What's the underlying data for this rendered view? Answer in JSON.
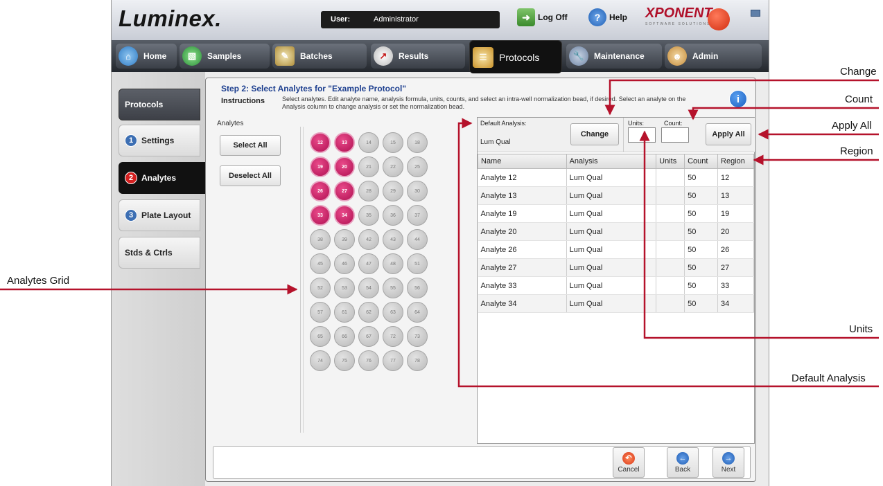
{
  "header": {
    "logo": "Luminex.",
    "user_label": "User:",
    "user_value": "Administrator",
    "logoff_label": "Log Off",
    "help_label": "Help",
    "brand": "XPONENT.",
    "brand_sub": "SOFTWARE SOLUTIONS"
  },
  "nav": {
    "tabs": [
      {
        "label": "Home",
        "icon": "home-icon"
      },
      {
        "label": "Samples",
        "icon": "samples-icon"
      },
      {
        "label": "Batches",
        "icon": "batches-icon"
      },
      {
        "label": "Results",
        "icon": "results-icon"
      },
      {
        "label": "Protocols",
        "icon": "protocols-icon",
        "active": true
      },
      {
        "label": "Maintenance",
        "icon": "maintenance-icon"
      },
      {
        "label": "Admin",
        "icon": "admin-icon"
      }
    ]
  },
  "sidebar": {
    "items": [
      {
        "label": "Protocols"
      },
      {
        "label": "Settings",
        "step": "1"
      },
      {
        "label": "Analytes",
        "step": "2"
      },
      {
        "label": "Plate Layout",
        "step": "3"
      },
      {
        "label": "Stds & Ctrls"
      }
    ]
  },
  "main": {
    "step_title": "Step 2: Select Analytes for \"Example Protocol\"",
    "instructions_label": "Instructions",
    "instructions_text": "Select analytes. Edit analyte name, analysis formula, units, counts, and select an intra-well normalization bead, if desired. Select an analyte on the Analysis column to change analysis or set the normalization bead.",
    "analytes_label": "Analytes",
    "select_all": "Select All",
    "deselect_all": "Deselect All",
    "beads": [
      {
        "id": "12",
        "selected": true
      },
      {
        "id": "13",
        "selected": true
      },
      {
        "id": "14",
        "selected": false
      },
      {
        "id": "15",
        "selected": false
      },
      {
        "id": "18",
        "selected": false
      },
      {
        "id": "19",
        "selected": true
      },
      {
        "id": "20",
        "selected": true
      },
      {
        "id": "21",
        "selected": false
      },
      {
        "id": "22",
        "selected": false
      },
      {
        "id": "25",
        "selected": false
      },
      {
        "id": "26",
        "selected": true
      },
      {
        "id": "27",
        "selected": true
      },
      {
        "id": "28",
        "selected": false
      },
      {
        "id": "29",
        "selected": false
      },
      {
        "id": "30",
        "selected": false
      },
      {
        "id": "33",
        "selected": true
      },
      {
        "id": "34",
        "selected": true
      },
      {
        "id": "35",
        "selected": false
      },
      {
        "id": "36",
        "selected": false
      },
      {
        "id": "37",
        "selected": false
      },
      {
        "id": "38",
        "selected": false
      },
      {
        "id": "39",
        "selected": false
      },
      {
        "id": "42",
        "selected": false
      },
      {
        "id": "43",
        "selected": false
      },
      {
        "id": "44",
        "selected": false
      },
      {
        "id": "45",
        "selected": false
      },
      {
        "id": "46",
        "selected": false
      },
      {
        "id": "47",
        "selected": false
      },
      {
        "id": "48",
        "selected": false
      },
      {
        "id": "51",
        "selected": false
      },
      {
        "id": "52",
        "selected": false
      },
      {
        "id": "53",
        "selected": false
      },
      {
        "id": "54",
        "selected": false
      },
      {
        "id": "55",
        "selected": false
      },
      {
        "id": "56",
        "selected": false
      },
      {
        "id": "57",
        "selected": false
      },
      {
        "id": "61",
        "selected": false
      },
      {
        "id": "62",
        "selected": false
      },
      {
        "id": "63",
        "selected": false
      },
      {
        "id": "64",
        "selected": false
      },
      {
        "id": "65",
        "selected": false
      },
      {
        "id": "66",
        "selected": false
      },
      {
        "id": "67",
        "selected": false
      },
      {
        "id": "72",
        "selected": false
      },
      {
        "id": "73",
        "selected": false
      },
      {
        "id": "74",
        "selected": false
      },
      {
        "id": "75",
        "selected": false
      },
      {
        "id": "76",
        "selected": false
      },
      {
        "id": "77",
        "selected": false
      },
      {
        "id": "78",
        "selected": false
      }
    ],
    "default_analysis_label": "Default Analysis:",
    "default_analysis_value": "Lum Qual",
    "change_label": "Change",
    "units_label": "Units:",
    "count_label": "Count:",
    "apply_all_label": "Apply All",
    "table": {
      "columns": [
        "Name",
        "Analysis",
        "Units",
        "Count",
        "Region"
      ],
      "rows": [
        [
          "Analyte 12",
          "Lum Qual",
          "",
          "50",
          "12"
        ],
        [
          "Analyte 13",
          "Lum Qual",
          "",
          "50",
          "13"
        ],
        [
          "Analyte 19",
          "Lum Qual",
          "",
          "50",
          "19"
        ],
        [
          "Analyte 20",
          "Lum Qual",
          "",
          "50",
          "20"
        ],
        [
          "Analyte 26",
          "Lum Qual",
          "",
          "50",
          "26"
        ],
        [
          "Analyte 27",
          "Lum Qual",
          "",
          "50",
          "27"
        ],
        [
          "Analyte 33",
          "Lum Qual",
          "",
          "50",
          "33"
        ],
        [
          "Analyte 34",
          "Lum Qual",
          "",
          "50",
          "34"
        ]
      ]
    },
    "cancel_label": "Cancel",
    "back_label": "Back",
    "next_label": "Next"
  },
  "callouts": {
    "change": "Change",
    "count": "Count",
    "apply_all": "Apply All",
    "region": "Region",
    "analytes_grid": "Analytes Grid",
    "units": "Units",
    "default_analysis": "Default Analysis"
  },
  "colors": {
    "callout_line": "#b5122b",
    "selected_bead": "#c4145e",
    "title_blue": "#1d3f8f"
  }
}
